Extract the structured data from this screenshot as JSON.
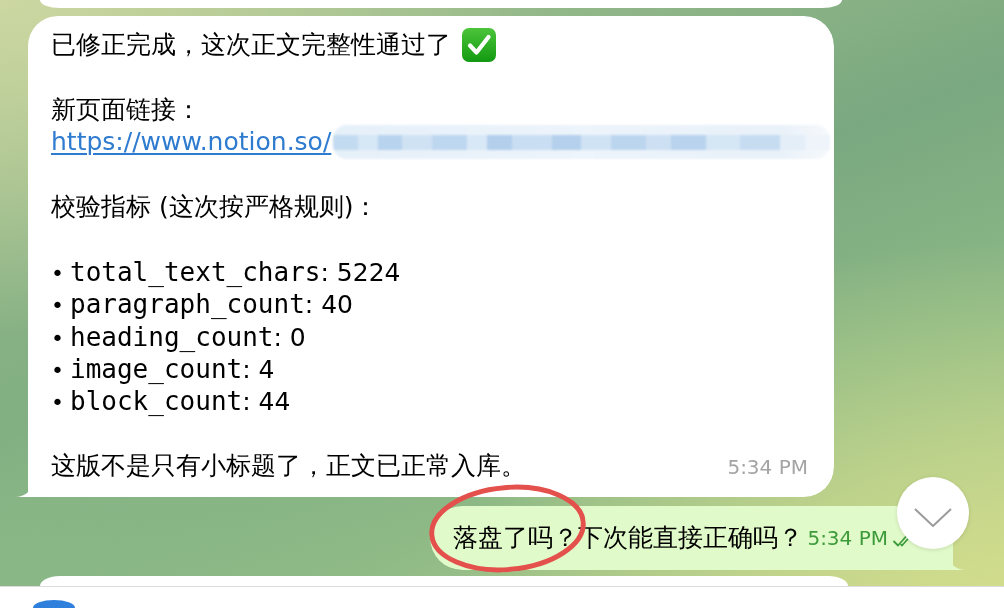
{
  "messages": [
    {
      "kind": "clipped-above"
    },
    {
      "kind": "incoming",
      "blocks": [
        {
          "kind": "status",
          "text": "已修正完成，这次正文完整性通过了"
        },
        {
          "kind": "link",
          "label": "新页面链接：",
          "url": "https://www.notion.so/",
          "redacted": true
        },
        {
          "kind": "text",
          "text": "校验指标 (这次按严格规则)："
        },
        {
          "kind": "list",
          "items": [
            {
              "bullet": "•",
              "code": "total_text_chars",
              "text": ": 5224"
            },
            {
              "bullet": "•",
              "code": "paragraph_count",
              "text": ": 40"
            },
            {
              "bullet": "•",
              "code": "heading_count",
              "text": ": 0"
            },
            {
              "bullet": "•",
              "code": "image_count",
              "text": ": 4"
            },
            {
              "bullet": "•",
              "code": "block_count",
              "text": ": 44"
            }
          ]
        },
        {
          "kind": "text",
          "text": "这版不是只有小标题了，正文已正常入库。"
        }
      ],
      "time": "5:34 PM"
    },
    {
      "kind": "outgoing",
      "segments": [
        {
          "text": "落盘了吗？",
          "circled": true
        },
        {
          "text": "下次能直接正确吗？",
          "circled": false
        }
      ],
      "time": "5:34 PM",
      "read": true
    },
    {
      "kind": "clipped-below"
    }
  ]
}
